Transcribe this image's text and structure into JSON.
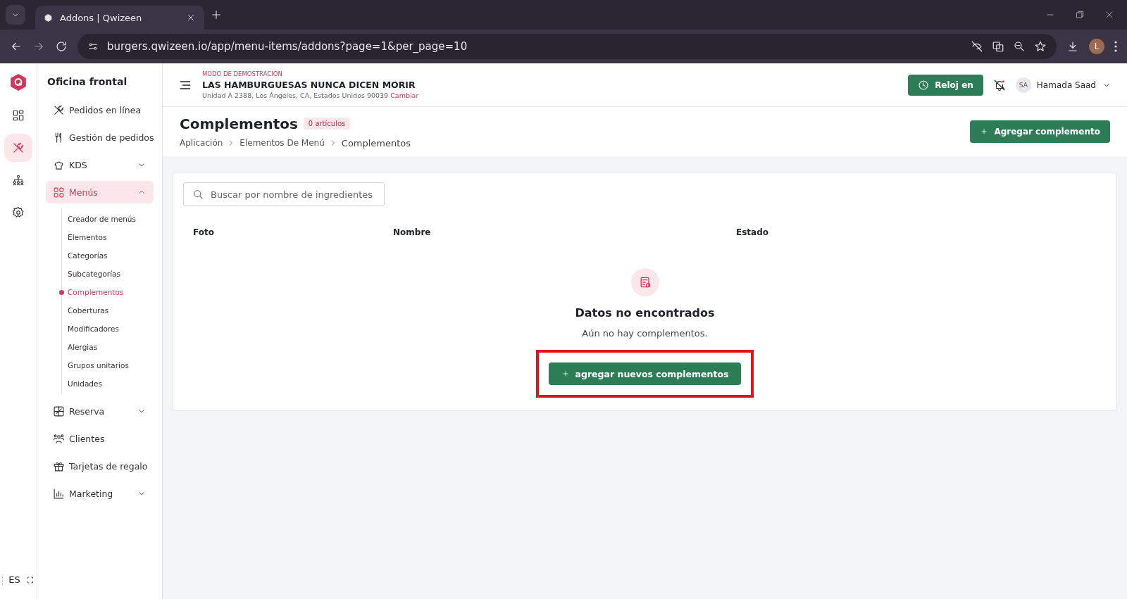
{
  "browser": {
    "tab_title": "Addons | Qwizeen",
    "url": "burgers.qwizeen.io/app/menu-items/addons?page=1&per_page=10",
    "avatar": "L"
  },
  "rail": [
    {
      "selected": false
    },
    {
      "selected": true
    },
    {
      "selected": false
    },
    {
      "selected": false
    }
  ],
  "language": "ES",
  "sidebar": {
    "title": "Oficina frontal",
    "items": [
      {
        "label": "Pedidos en línea",
        "kind": "link",
        "selected": false
      },
      {
        "label": "Gestión de pedidos",
        "kind": "link",
        "selected": false
      },
      {
        "label": "KDS",
        "kind": "group",
        "expanded": false,
        "selected": false
      },
      {
        "label": "Menús",
        "kind": "group",
        "expanded": true,
        "selected": true,
        "children": [
          {
            "label": "Creador de menús",
            "selected": false
          },
          {
            "label": "Elementos",
            "selected": false
          },
          {
            "label": "Categorías",
            "selected": false
          },
          {
            "label": "Subcategorías",
            "selected": false
          },
          {
            "label": "Complementos",
            "selected": true
          },
          {
            "label": "Coberturas",
            "selected": false
          },
          {
            "label": "Modificadores",
            "selected": false
          },
          {
            "label": "Alergias",
            "selected": false
          },
          {
            "label": "Grupos unitarios",
            "selected": false
          },
          {
            "label": "Unidades",
            "selected": false
          }
        ]
      },
      {
        "label": "Reserva",
        "kind": "group",
        "expanded": false,
        "selected": false
      },
      {
        "label": "Clientes",
        "kind": "link",
        "selected": false
      },
      {
        "label": "Tarjetas de regalo",
        "kind": "link",
        "selected": false
      },
      {
        "label": "Marketing",
        "kind": "group",
        "expanded": false,
        "selected": false
      }
    ]
  },
  "header": {
    "demo_label": "MODO DE DEMOSTRACIÓN",
    "restaurant": "LAS HAMBURGUESAS NUNCA DICEN MORIR",
    "address": "Unidad A 2388, Los Ángeles, CA, Estados Unidos 90039",
    "change_link": "Cambiar",
    "clock_button": "Reloj en",
    "user_initials": "SA",
    "user_name": "Hamada Saad"
  },
  "page": {
    "title": "Complementos",
    "count": "0 artículos",
    "breadcrumbs": [
      "Aplicación",
      "Elementos De Menú",
      "Complementos"
    ],
    "add_button": "Agregar complemento"
  },
  "table": {
    "search": {
      "placeholder": "Buscar por nombre de ingredientes"
    },
    "columns": [
      "Foto",
      "Nombre",
      "Estado"
    ]
  },
  "empty_state": {
    "title": "Datos no encontrados",
    "message": "Aún no hay complementos.",
    "button": "agregar nuevos complementos",
    "highlighted": true
  }
}
